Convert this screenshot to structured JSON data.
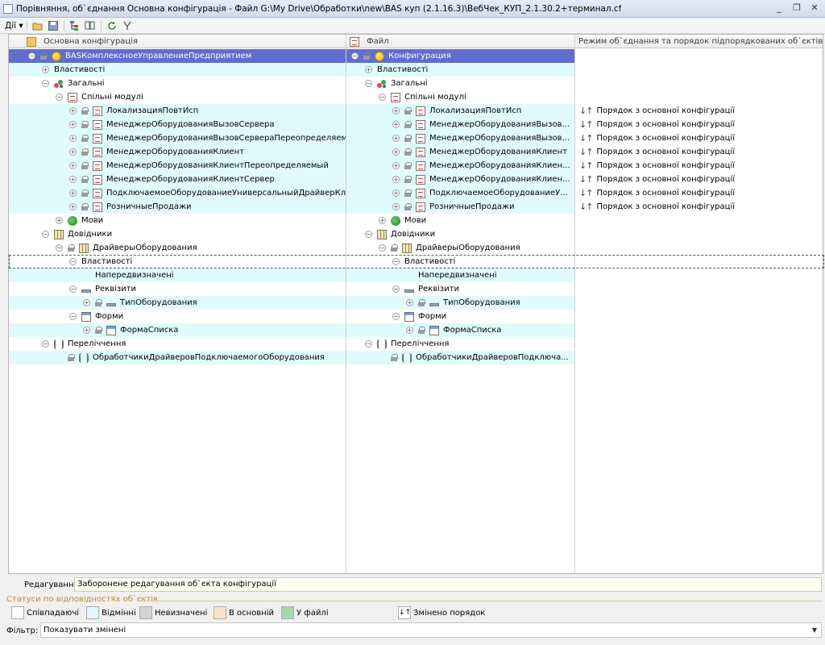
{
  "window": {
    "title": "Порівняння, об`єднання Основна конфігурація - Файл G:\\My Drive\\Обработки\\new\\BAS куп (2.1.16.3)\\ВебЧек_КУП_2.1.30.2+терминал.cf",
    "minimize": "_",
    "restore": "❐",
    "close": "✕"
  },
  "toolbar": {
    "actions_label": "Дії ▾"
  },
  "columns": {
    "main": "Основна конфігурація",
    "file": "Файл",
    "mode": "Режим об`єднання та порядок підпорядкованих об`єктів"
  },
  "rows": [
    {
      "c1": "BASКомплексноеУправлениеПредприятием",
      "c2": "Конфигурация",
      "mode": ""
    },
    {
      "c1": "Властивості",
      "c2": "Властивості",
      "mode": ""
    },
    {
      "c1": "Загальні",
      "c2": "Загальні",
      "mode": ""
    },
    {
      "c1": "Спільні модулі",
      "c2": "Спільні модулі",
      "mode": ""
    },
    {
      "c1": "ЛокализацияПовтИсп",
      "c2": "ЛокализацияПовтИсп",
      "mode": "Порядок з основної конфігурації"
    },
    {
      "c1": "МенеджерОборудованияВызовСервера",
      "c2": "МенеджерОборудованияВызов...",
      "mode": "Порядок з основної конфігурації"
    },
    {
      "c1": "МенеджерОборудованияВызовСервераПереопределяемый",
      "c2": "МенеджерОборудованияВызов...",
      "mode": "Порядок з основної конфігурації"
    },
    {
      "c1": "МенеджерОборудованияКлиент",
      "c2": "МенеджерОборудованияКлиент",
      "mode": "Порядок з основної конфігурації"
    },
    {
      "c1": "МенеджерОборудованияКлиентПереопределяемый",
      "c2": "МенеджерОборудованияКлиен...",
      "mode": "Порядок з основної конфігурації"
    },
    {
      "c1": "МенеджерОборудованияКлиентСервер",
      "c2": "МенеджерОборудованияКлиен...",
      "mode": "Порядок з основної конфігурації"
    },
    {
      "c1": "ПодключаемоеОборудованиеУниверсальныйДрайверКлиент",
      "c2": "ПодключаемоеОборудованиеУ...",
      "mode": "Порядок з основної конфігурації"
    },
    {
      "c1": "РозничныеПродажи",
      "c2": "РозничныеПродажи",
      "mode": "Порядок з основної конфігурації"
    },
    {
      "c1": "Мови",
      "c2": "Мови",
      "mode": ""
    },
    {
      "c1": "Довідники",
      "c2": "Довідники",
      "mode": ""
    },
    {
      "c1": "ДрайверыОборудования",
      "c2": "ДрайверыОборудования",
      "mode": ""
    },
    {
      "c1": "Властивості",
      "c2": "Властивості",
      "mode": ""
    },
    {
      "c1": "Напередвизначені",
      "c2": "Напередвизначені",
      "mode": ""
    },
    {
      "c1": "Реквізити",
      "c2": "Реквізити",
      "mode": ""
    },
    {
      "c1": "ТипОборудования",
      "c2": "ТипОборудования",
      "mode": ""
    },
    {
      "c1": "Форми",
      "c2": "Форми",
      "mode": ""
    },
    {
      "c1": "ФормаСписка",
      "c2": "ФормаСписка",
      "mode": ""
    },
    {
      "c1": "Переліччення",
      "c2": "Переліччення",
      "mode": ""
    },
    {
      "c1": "ОбработчикиДрайверовПодключаемогоОборудования",
      "c2": "ОбработчикиДрайверовПодключа...",
      "mode": ""
    }
  ],
  "editing": {
    "label": "Редагування:",
    "value": "Заборонене редагування об`єкта конфігурації"
  },
  "legend": {
    "title": "Статуси по відповідностях об`єктів",
    "items": [
      {
        "label": "Співпадаючі",
        "color": "#ffffff"
      },
      {
        "label": "Відмінні",
        "color": "#e0fbfd"
      },
      {
        "label": "Невизначені",
        "color": "#d4d4d4"
      },
      {
        "label": "В основній",
        "color": "#fbe3c8"
      },
      {
        "label": "У файлі",
        "color": "#a8d8a8"
      }
    ],
    "changed_order": "Змінено порядок"
  },
  "filter": {
    "label": "Фільтр:",
    "value": "Показувати змінені"
  }
}
